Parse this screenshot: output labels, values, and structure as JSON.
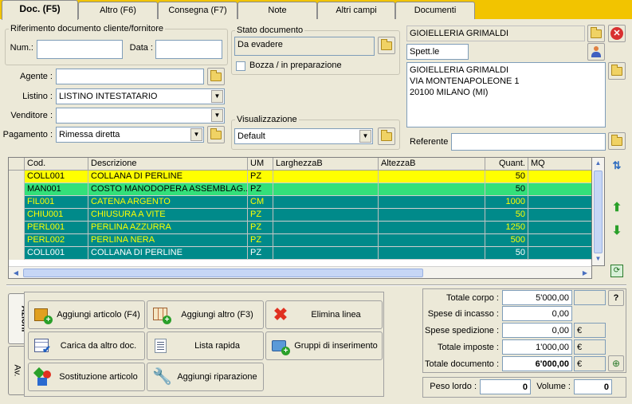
{
  "tabs": [
    {
      "label": "Doc. (F5)"
    },
    {
      "label": "Altro (F6)"
    },
    {
      "label": "Consegna (F7)"
    },
    {
      "label": "Note"
    },
    {
      "label": "Altri campi"
    },
    {
      "label": "Documenti"
    }
  ],
  "riferimento": {
    "legend": "Riferimento documento cliente/fornitore",
    "num_label": "Num.:",
    "num_value": "",
    "data_label": "Data :",
    "data_value": ""
  },
  "stato": {
    "legend": "Stato documento",
    "value": "Da evadere",
    "bozza_label": "Bozza / in preparazione",
    "bozza_checked": false
  },
  "cliente": {
    "name": "GIOIELLERIA GRIMALDI",
    "salutation": "Spett.le",
    "address": [
      "GIOIELLERIA GRIMALDI",
      "VIA MONTENAPOLEONE 1",
      "20100 MILANO (MI)"
    ],
    "referente_label": "Referente",
    "referente_value": ""
  },
  "fields": {
    "agente_label": "Agente :",
    "agente_value": "",
    "listino_label": "Listino :",
    "listino_value": "LISTINO INTESTATARIO",
    "venditore_label": "Venditore :",
    "venditore_value": "",
    "pagamento_label": "Pagamento :",
    "pagamento_value": "Rimessa diretta"
  },
  "visualizzazione": {
    "legend": "Visualizzazione",
    "value": "Default"
  },
  "grid": {
    "columns": [
      "Cod.",
      "Descrizione",
      "UM",
      "LarghezzaB",
      "AltezzaB",
      "Quant.",
      "MQ"
    ],
    "rows": [
      {
        "cod": "COLL001",
        "desc": "COLLANA DI PERLINE",
        "um": "PZ",
        "larg": "",
        "alt": "",
        "quant": "50",
        "mq": "",
        "bg": "#ffff00",
        "fg": "#000000"
      },
      {
        "cod": "MAN001",
        "desc": "COSTO MANODOPERA ASSEMBLAG...",
        "um": "PZ",
        "larg": "",
        "alt": "",
        "quant": "50",
        "mq": "",
        "bg": "#33e07a",
        "fg": "#000000"
      },
      {
        "cod": "FIL001",
        "desc": "CATENA ARGENTO",
        "um": "CM",
        "larg": "",
        "alt": "",
        "quant": "1000",
        "mq": "",
        "bg": "#008a8a",
        "fg": "#ffff00"
      },
      {
        "cod": "CHIU001",
        "desc": "CHIUSURA A VITE",
        "um": "PZ",
        "larg": "",
        "alt": "",
        "quant": "50",
        "mq": "",
        "bg": "#008a8a",
        "fg": "#ffff00"
      },
      {
        "cod": "PERL001",
        "desc": "PERLINA AZZURRA",
        "um": "PZ",
        "larg": "",
        "alt": "",
        "quant": "1250",
        "mq": "",
        "bg": "#008a8a",
        "fg": "#ffff00"
      },
      {
        "cod": "PERL002",
        "desc": "PERLINA NERA",
        "um": "PZ",
        "larg": "",
        "alt": "",
        "quant": "500",
        "mq": "",
        "bg": "#008a8a",
        "fg": "#ffff00"
      },
      {
        "cod": "COLL001",
        "desc": "COLLANA DI PERLINE",
        "um": "PZ",
        "larg": "",
        "alt": "",
        "quant": "50",
        "mq": "",
        "bg": "#008a8a",
        "fg": "#ffffff"
      }
    ]
  },
  "side_tabs": [
    {
      "label": "Azioni"
    },
    {
      "label": "Av."
    }
  ],
  "actions": [
    {
      "label": "Aggiungi articolo (F4)",
      "icon": "box-add-icon"
    },
    {
      "label": "Aggiungi altro (F3)",
      "icon": "grid-add-icon"
    },
    {
      "label": "Elimina linea",
      "icon": "delete-x-icon"
    },
    {
      "label": "Carica da altro doc.",
      "icon": "table-check-icon"
    },
    {
      "label": "Lista rapida",
      "icon": "list-icon"
    },
    {
      "label": "Gruppi di inserimento",
      "icon": "group-add-icon"
    },
    {
      "label": "Sostituzione articolo",
      "icon": "swap-shapes-icon"
    },
    {
      "label": "Aggiungi riparazione",
      "icon": "wrench-icon"
    }
  ],
  "totals": {
    "corpo_label": "Totale corpo :",
    "corpo_value": "5'000,00",
    "incasso_label": "Spese di incasso :",
    "incasso_value": "0,00",
    "spedizione_label": "Spese spedizione :",
    "spedizione_value": "0,00",
    "imposte_label": "Totale imposte :",
    "imposte_value": "1'000,00",
    "documento_label": "Totale documento :",
    "documento_value": "6'000,00",
    "currency": "€",
    "peso_label": "Peso lordo :",
    "peso_value": "0",
    "volume_label": "Volume :",
    "volume_value": "0",
    "help_label": "?"
  }
}
